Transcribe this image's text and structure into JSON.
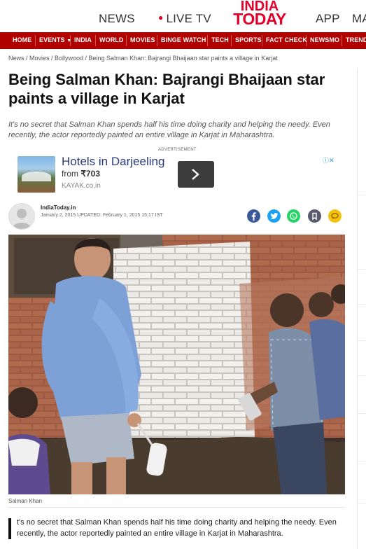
{
  "topbar": {
    "news": "NEWS",
    "live_tv": "LIVE TV",
    "logo_line1": "INDIA",
    "logo_line2": "TODAY",
    "app": "APP",
    "more": "MA"
  },
  "nav": [
    "HOME",
    "EVENTS",
    "INDIA",
    "WORLD",
    "MOVIES",
    "BINGE WATCH",
    "TECH",
    "SPORTS",
    "FACT CHECK",
    "NEWSMO",
    "TREND"
  ],
  "breadcrumb": "News / Movies / Bollywood / Being Salman Khan: Bajrangi Bhaijaan star paints a village in Karjat",
  "article": {
    "headline": "Being Salman Khan: Bajrangi Bhaijaan star paints a village in Karjat",
    "summary": "It's no secret that Salman Khan spends half his time doing charity and helping the needy. Even recently, the actor reportedly painted an entire village in Karjat in Maharashtra.",
    "author": "IndiaToday.in",
    "date": "January 2, 2015 UPDATED: February 1, 2015 15:17 IST",
    "caption": "Salman Khan",
    "body": "t's no secret that Salman Khan spends half his time doing charity and helping the needy. Even recently, the actor reportedly painted an entire village in Karjat in Maharashtra."
  },
  "ad": {
    "label": "ADVERTISEMENT",
    "title": "Hotels in Darjeeling",
    "price_prefix": "from ",
    "price": "₹703",
    "source": "KAYAK.co.in",
    "choices": "ⓘ✕"
  },
  "colors": {
    "brand_red": "#e4002b",
    "nav_red": "#b10000",
    "facebook": "#3b5998",
    "twitter": "#1da1f2",
    "whatsapp": "#25d366",
    "bookmark": "#5a5a6e",
    "comment": "#f4c20d"
  },
  "icons": [
    "facebook-icon",
    "twitter-icon",
    "whatsapp-icon",
    "bookmark-icon",
    "comment-icon",
    "chevron-right-icon",
    "dropdown-caret-icon"
  ]
}
